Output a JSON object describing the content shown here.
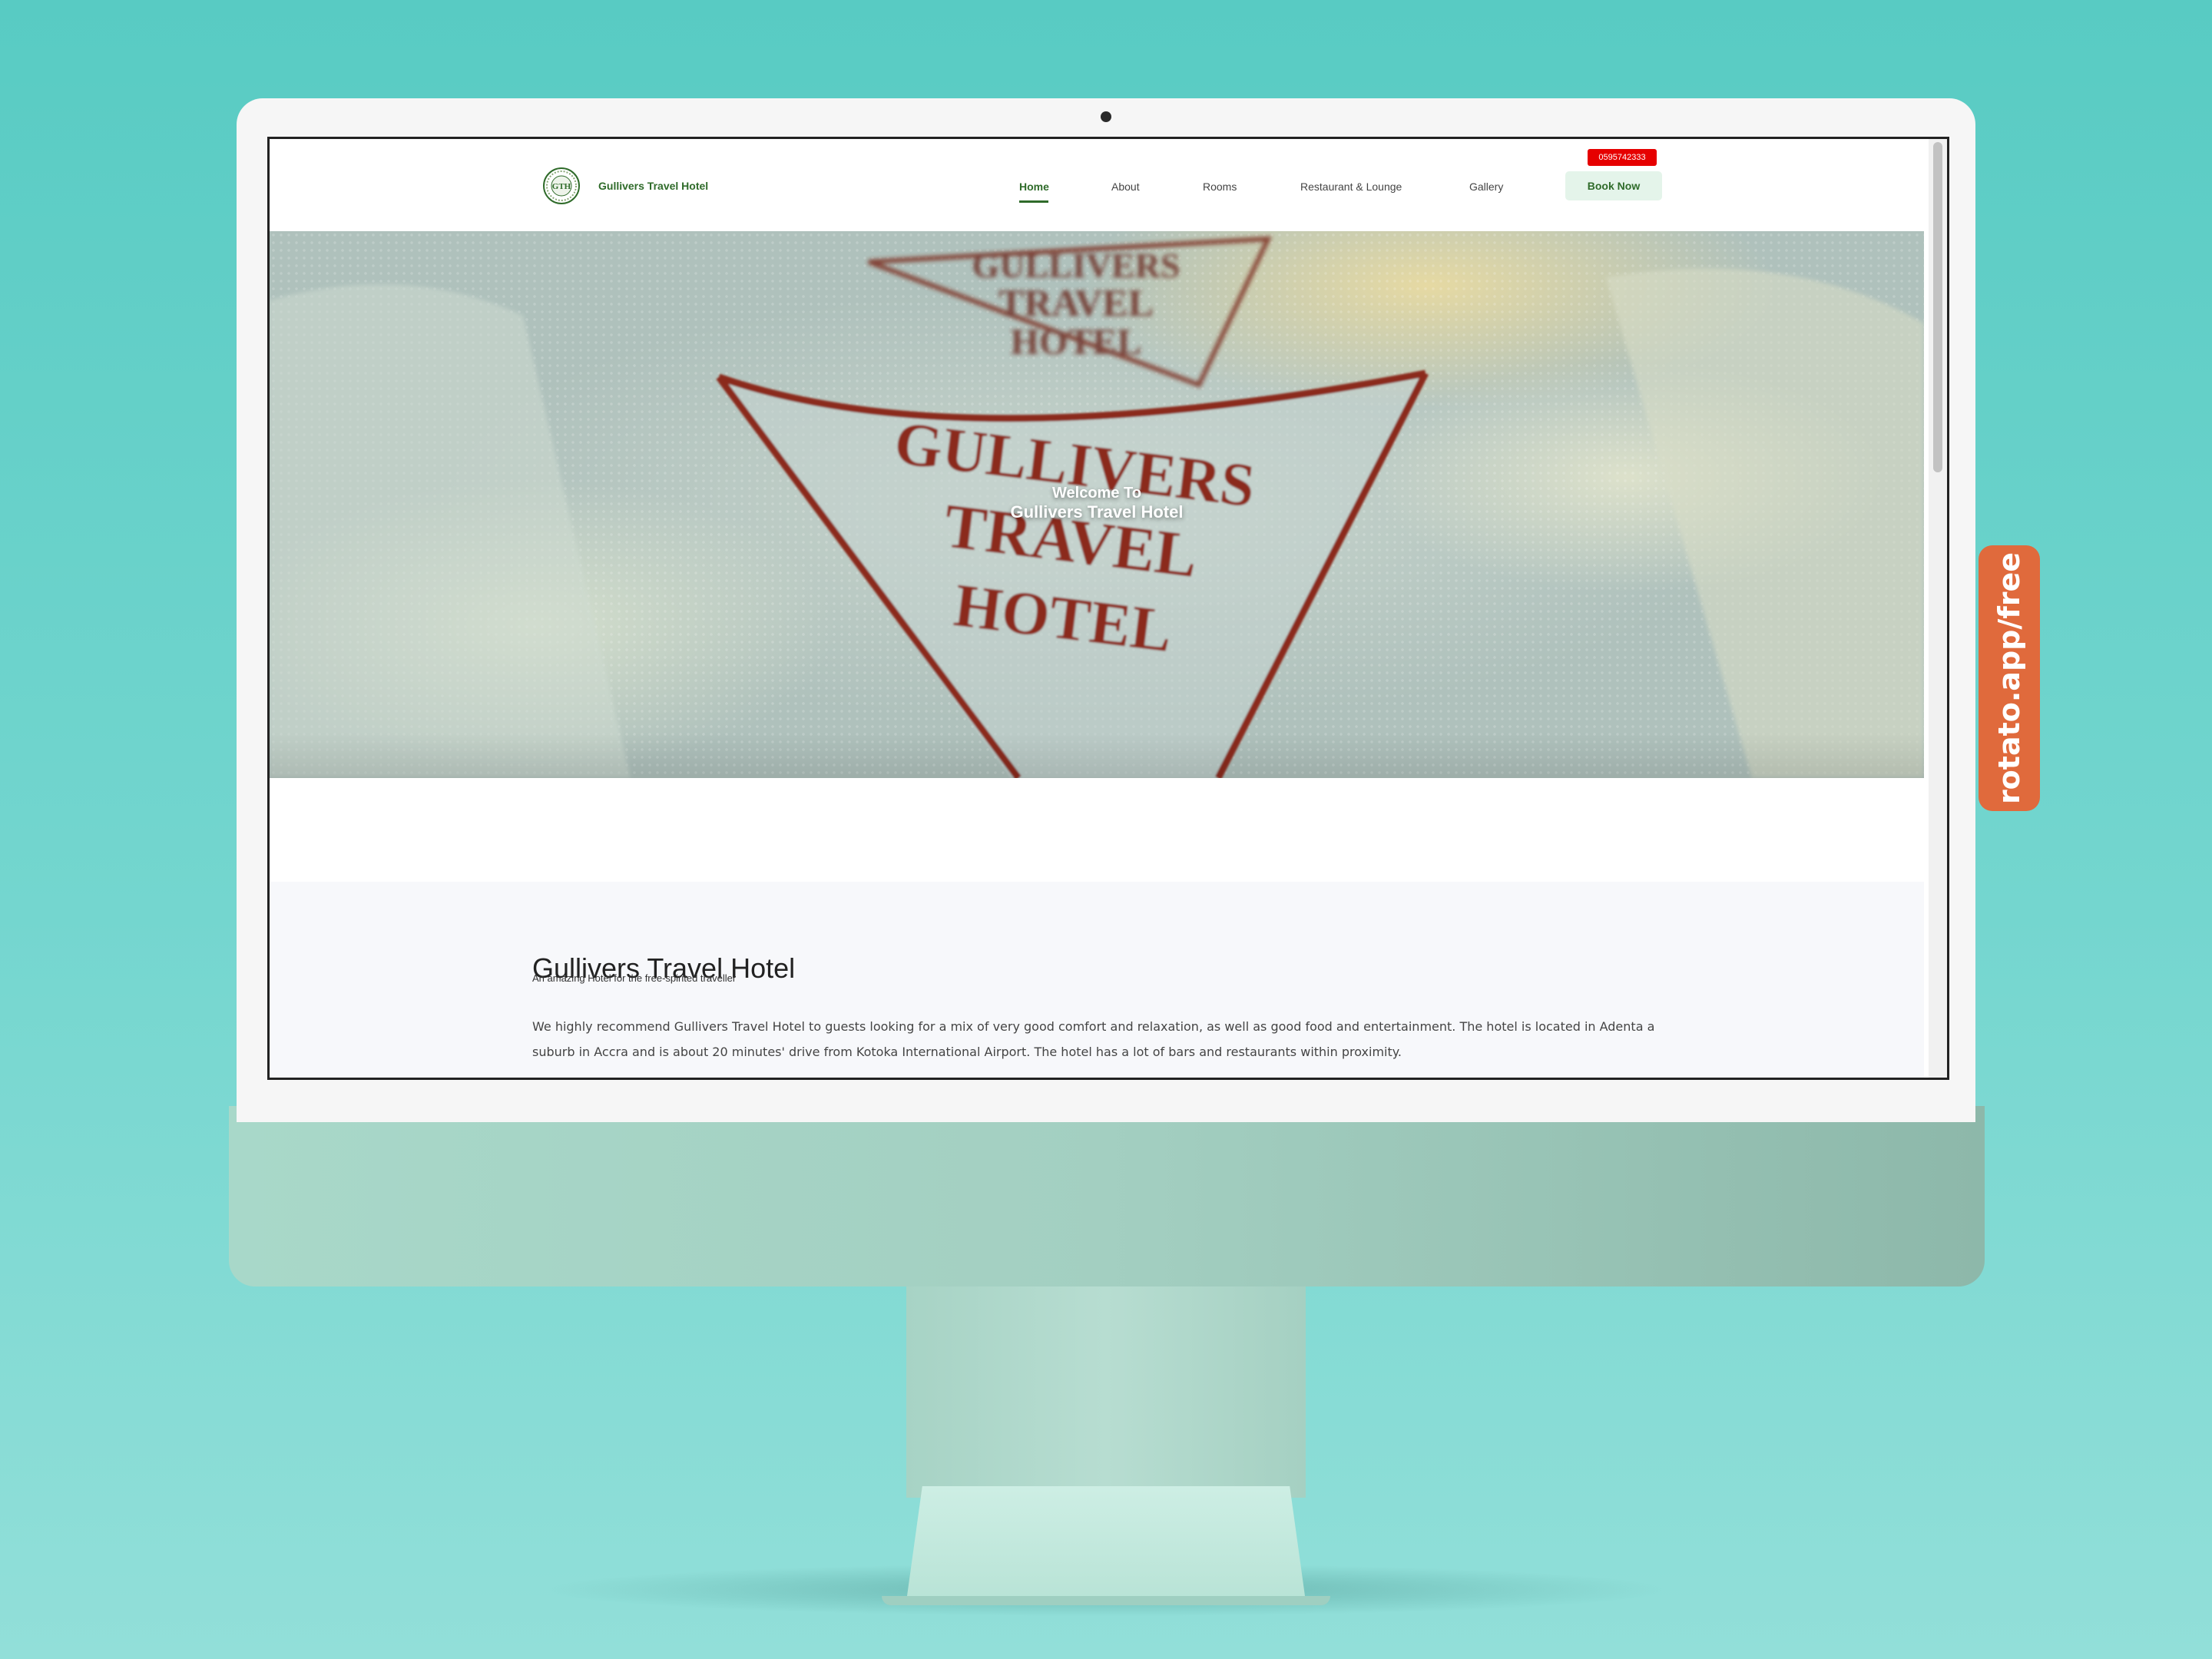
{
  "site": {
    "brand": "Gullivers Travel Hotel",
    "logo_text": "GTH",
    "nav": [
      {
        "label": "Home",
        "active": true
      },
      {
        "label": "About",
        "active": false
      },
      {
        "label": "Rooms",
        "active": false
      },
      {
        "label": "Restaurant & Lounge",
        "active": false
      },
      {
        "label": "Gallery",
        "active": false
      }
    ],
    "phone": "0595742333",
    "cta_label": "Book Now"
  },
  "hero": {
    "line1": "Welcome To",
    "line2": "Gullivers Travel Hotel",
    "embroidery": {
      "line1": "GULLIVERS",
      "line2": "TRAVEL",
      "line3": "HOTEL",
      "top_line1": "GULLIVERS",
      "top_line2": "TRAVEL",
      "top_line3": "HOTEL"
    }
  },
  "about": {
    "title": "Gullivers Travel Hotel",
    "subtitle": "An amazing Hotel for the free-spirited traveller",
    "body": "We highly recommend Gullivers Travel Hotel to guests looking for a mix of very good comfort and relaxation, as well as good food and entertainment. The hotel is located in Adenta a suburb in Accra and is about 20 minutes' drive from Kotoka International Airport. The hotel has a lot of bars and restaurants within proximity."
  },
  "watermark": "rotato.app/free",
  "colors": {
    "brand_green": "#2f6b2a",
    "phone_badge": "#e60000",
    "cta_bg": "#e4f4ea",
    "embroidery": "#8b2a1e",
    "background": "#5ccbc3"
  }
}
